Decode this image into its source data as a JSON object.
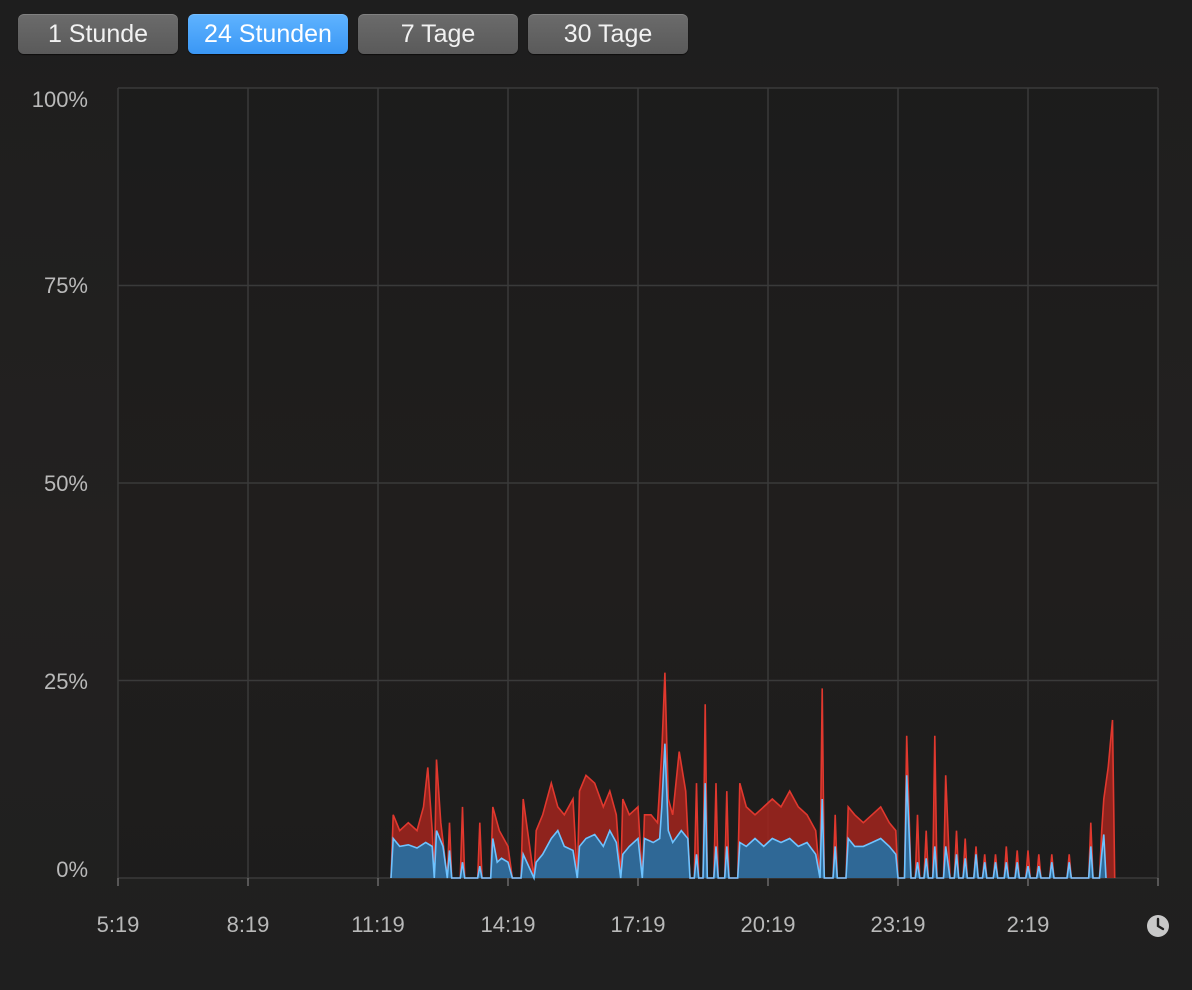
{
  "toolbar": {
    "buttons": [
      {
        "label": "1 Stunde",
        "active": false
      },
      {
        "label": "24 Stunden",
        "active": true
      },
      {
        "label": "7 Tage",
        "active": false
      },
      {
        "label": "30 Tage",
        "active": false
      }
    ]
  },
  "colors": {
    "user": "#3b82c4",
    "user_line": "#6ec3ff",
    "system": "#e0382e",
    "grid": "#3a3a3a",
    "accent": "#3a97f5"
  },
  "icons": {
    "time_icon": "clock-icon"
  },
  "chart_data": {
    "type": "area",
    "stacked": true,
    "title": "",
    "xlabel": "",
    "ylabel": "",
    "ylim": [
      0,
      100
    ],
    "y_ticks": [
      "100%",
      "75%",
      "50%",
      "25%",
      "0%"
    ],
    "x_ticks": [
      "5:19",
      "8:19",
      "11:19",
      "14:19",
      "17:19",
      "20:19",
      "23:19",
      "2:19"
    ],
    "x_range_hours": [
      0,
      24
    ],
    "grid": true,
    "series": [
      {
        "color": "#3b82c4",
        "points": [
          [
            6.3,
            0
          ],
          [
            6.35,
            5
          ],
          [
            6.5,
            4
          ],
          [
            6.7,
            4.2
          ],
          [
            6.9,
            3.8
          ],
          [
            7.1,
            4.5
          ],
          [
            7.25,
            4
          ],
          [
            7.3,
            0
          ],
          [
            7.35,
            6
          ],
          [
            7.5,
            4
          ],
          [
            7.6,
            0
          ],
          [
            7.65,
            3.5
          ],
          [
            7.7,
            0
          ],
          [
            7.9,
            0
          ],
          [
            7.95,
            2
          ],
          [
            8.0,
            0
          ],
          [
            8.3,
            0
          ],
          [
            8.35,
            1.5
          ],
          [
            8.4,
            0
          ],
          [
            8.6,
            0
          ],
          [
            8.65,
            5
          ],
          [
            8.75,
            2
          ],
          [
            8.85,
            2.5
          ],
          [
            9.0,
            2
          ],
          [
            9.1,
            0
          ],
          [
            9.3,
            0
          ],
          [
            9.35,
            3
          ],
          [
            9.6,
            0
          ],
          [
            9.65,
            2
          ],
          [
            9.8,
            3
          ],
          [
            10.0,
            5
          ],
          [
            10.15,
            6
          ],
          [
            10.3,
            4
          ],
          [
            10.5,
            3.5
          ],
          [
            10.6,
            0
          ],
          [
            10.65,
            4
          ],
          [
            10.8,
            5
          ],
          [
            11.0,
            5.5
          ],
          [
            11.2,
            4
          ],
          [
            11.35,
            6
          ],
          [
            11.5,
            4.5
          ],
          [
            11.6,
            0
          ],
          [
            11.65,
            3
          ],
          [
            11.8,
            4
          ],
          [
            12.0,
            5
          ],
          [
            12.1,
            0
          ],
          [
            12.15,
            5
          ],
          [
            12.35,
            4.5
          ],
          [
            12.5,
            5
          ],
          [
            12.55,
            9
          ],
          [
            12.62,
            17
          ],
          [
            12.7,
            6
          ],
          [
            12.8,
            4.5
          ],
          [
            13.0,
            6
          ],
          [
            13.15,
            5
          ],
          [
            13.2,
            0
          ],
          [
            13.3,
            0
          ],
          [
            13.35,
            3
          ],
          [
            13.4,
            0
          ],
          [
            13.5,
            0
          ],
          [
            13.55,
            12
          ],
          [
            13.6,
            0
          ],
          [
            13.75,
            0
          ],
          [
            13.8,
            4
          ],
          [
            13.85,
            0
          ],
          [
            14.0,
            0
          ],
          [
            14.05,
            4
          ],
          [
            14.1,
            0
          ],
          [
            14.3,
            0
          ],
          [
            14.35,
            4.5
          ],
          [
            14.5,
            4
          ],
          [
            14.7,
            5
          ],
          [
            14.9,
            4
          ],
          [
            15.1,
            5
          ],
          [
            15.3,
            4.5
          ],
          [
            15.5,
            5
          ],
          [
            15.7,
            4
          ],
          [
            15.9,
            4.5
          ],
          [
            16.1,
            3
          ],
          [
            16.2,
            0
          ],
          [
            16.25,
            10
          ],
          [
            16.3,
            0
          ],
          [
            16.5,
            0
          ],
          [
            16.55,
            4
          ],
          [
            16.6,
            0
          ],
          [
            16.8,
            0
          ],
          [
            16.85,
            5
          ],
          [
            17.0,
            4
          ],
          [
            17.2,
            4
          ],
          [
            17.4,
            4.5
          ],
          [
            17.6,
            5
          ],
          [
            17.8,
            4
          ],
          [
            17.95,
            3
          ],
          [
            18.0,
            0
          ],
          [
            18.15,
            0
          ],
          [
            18.2,
            13
          ],
          [
            18.3,
            0
          ],
          [
            18.4,
            0
          ],
          [
            18.45,
            2
          ],
          [
            18.5,
            0
          ],
          [
            18.6,
            0
          ],
          [
            18.65,
            2.5
          ],
          [
            18.7,
            0
          ],
          [
            18.8,
            0
          ],
          [
            18.85,
            4
          ],
          [
            18.9,
            0
          ],
          [
            19.05,
            0
          ],
          [
            19.1,
            4
          ],
          [
            19.2,
            0
          ],
          [
            19.3,
            0
          ],
          [
            19.35,
            3
          ],
          [
            19.4,
            0
          ],
          [
            19.5,
            0
          ],
          [
            19.55,
            2.5
          ],
          [
            19.6,
            0
          ],
          [
            19.75,
            0
          ],
          [
            19.8,
            3
          ],
          [
            19.85,
            0
          ],
          [
            19.95,
            0
          ],
          [
            20.0,
            2
          ],
          [
            20.05,
            0
          ],
          [
            20.2,
            0
          ],
          [
            20.25,
            2
          ],
          [
            20.3,
            0
          ],
          [
            20.45,
            0
          ],
          [
            20.5,
            2
          ],
          [
            20.55,
            0
          ],
          [
            20.7,
            0
          ],
          [
            20.75,
            2
          ],
          [
            20.8,
            0
          ],
          [
            20.95,
            0
          ],
          [
            21.0,
            1.5
          ],
          [
            21.05,
            0
          ],
          [
            21.2,
            0
          ],
          [
            21.25,
            1.5
          ],
          [
            21.3,
            0
          ],
          [
            21.5,
            0
          ],
          [
            21.55,
            2
          ],
          [
            21.6,
            0
          ],
          [
            21.9,
            0
          ],
          [
            21.95,
            2
          ],
          [
            22.0,
            0
          ],
          [
            22.4,
            0
          ],
          [
            22.45,
            4
          ],
          [
            22.5,
            0
          ],
          [
            22.65,
            0
          ],
          [
            22.7,
            3
          ],
          [
            22.75,
            5.5
          ],
          [
            22.8,
            0
          ]
        ]
      },
      {
        "color": "#e0382e",
        "points": [
          [
            6.3,
            0
          ],
          [
            6.35,
            8
          ],
          [
            6.5,
            6
          ],
          [
            6.7,
            7
          ],
          [
            6.9,
            6
          ],
          [
            7.05,
            9
          ],
          [
            7.15,
            14
          ],
          [
            7.25,
            6
          ],
          [
            7.3,
            0
          ],
          [
            7.35,
            15
          ],
          [
            7.45,
            7
          ],
          [
            7.6,
            0
          ],
          [
            7.65,
            7
          ],
          [
            7.7,
            0
          ],
          [
            7.9,
            0
          ],
          [
            7.95,
            9
          ],
          [
            8.0,
            0
          ],
          [
            8.3,
            0
          ],
          [
            8.35,
            7
          ],
          [
            8.4,
            0
          ],
          [
            8.6,
            0
          ],
          [
            8.65,
            9
          ],
          [
            8.8,
            6
          ],
          [
            9.0,
            4
          ],
          [
            9.1,
            0
          ],
          [
            9.3,
            0
          ],
          [
            9.35,
            10
          ],
          [
            9.6,
            0
          ],
          [
            9.65,
            6
          ],
          [
            9.8,
            8
          ],
          [
            10.0,
            12
          ],
          [
            10.15,
            9
          ],
          [
            10.3,
            8
          ],
          [
            10.5,
            10
          ],
          [
            10.6,
            0
          ],
          [
            10.65,
            11
          ],
          [
            10.8,
            13
          ],
          [
            11.0,
            12
          ],
          [
            11.2,
            9
          ],
          [
            11.35,
            11
          ],
          [
            11.5,
            8
          ],
          [
            11.6,
            0
          ],
          [
            11.65,
            10
          ],
          [
            11.8,
            8
          ],
          [
            12.0,
            9
          ],
          [
            12.1,
            0
          ],
          [
            12.15,
            8
          ],
          [
            12.3,
            8
          ],
          [
            12.45,
            7
          ],
          [
            12.55,
            16
          ],
          [
            12.62,
            26
          ],
          [
            12.7,
            10
          ],
          [
            12.8,
            8
          ],
          [
            12.95,
            16
          ],
          [
            13.1,
            11
          ],
          [
            13.2,
            0
          ],
          [
            13.3,
            0
          ],
          [
            13.35,
            12
          ],
          [
            13.4,
            0
          ],
          [
            13.5,
            0
          ],
          [
            13.55,
            22
          ],
          [
            13.6,
            0
          ],
          [
            13.75,
            0
          ],
          [
            13.8,
            12
          ],
          [
            13.85,
            0
          ],
          [
            14.0,
            0
          ],
          [
            14.05,
            11
          ],
          [
            14.1,
            0
          ],
          [
            14.3,
            0
          ],
          [
            14.35,
            12
          ],
          [
            14.5,
            9
          ],
          [
            14.7,
            8
          ],
          [
            14.9,
            9
          ],
          [
            15.1,
            10
          ],
          [
            15.3,
            9
          ],
          [
            15.5,
            11
          ],
          [
            15.7,
            9
          ],
          [
            15.9,
            8
          ],
          [
            16.1,
            6
          ],
          [
            16.2,
            0
          ],
          [
            16.25,
            24
          ],
          [
            16.3,
            0
          ],
          [
            16.5,
            0
          ],
          [
            16.55,
            8
          ],
          [
            16.6,
            0
          ],
          [
            16.8,
            0
          ],
          [
            16.85,
            9
          ],
          [
            17.0,
            8
          ],
          [
            17.2,
            7
          ],
          [
            17.4,
            8
          ],
          [
            17.6,
            9
          ],
          [
            17.8,
            7
          ],
          [
            17.95,
            6
          ],
          [
            18.0,
            0
          ],
          [
            18.15,
            0
          ],
          [
            18.2,
            18
          ],
          [
            18.3,
            0
          ],
          [
            18.4,
            0
          ],
          [
            18.45,
            8
          ],
          [
            18.5,
            0
          ],
          [
            18.6,
            0
          ],
          [
            18.65,
            6
          ],
          [
            18.7,
            0
          ],
          [
            18.8,
            0
          ],
          [
            18.85,
            18
          ],
          [
            18.9,
            0
          ],
          [
            19.05,
            0
          ],
          [
            19.1,
            13
          ],
          [
            19.2,
            0
          ],
          [
            19.3,
            0
          ],
          [
            19.35,
            6
          ],
          [
            19.4,
            0
          ],
          [
            19.5,
            0
          ],
          [
            19.55,
            5
          ],
          [
            19.6,
            0
          ],
          [
            19.75,
            0
          ],
          [
            19.8,
            4
          ],
          [
            19.85,
            0
          ],
          [
            19.95,
            0
          ],
          [
            20.0,
            3
          ],
          [
            20.05,
            0
          ],
          [
            20.2,
            0
          ],
          [
            20.25,
            3
          ],
          [
            20.3,
            0
          ],
          [
            20.45,
            0
          ],
          [
            20.5,
            4
          ],
          [
            20.55,
            0
          ],
          [
            20.7,
            0
          ],
          [
            20.75,
            3.5
          ],
          [
            20.8,
            0
          ],
          [
            20.95,
            0
          ],
          [
            21.0,
            3.5
          ],
          [
            21.05,
            0
          ],
          [
            21.2,
            0
          ],
          [
            21.25,
            3
          ],
          [
            21.3,
            0
          ],
          [
            21.5,
            0
          ],
          [
            21.55,
            3
          ],
          [
            21.6,
            0
          ],
          [
            21.9,
            0
          ],
          [
            21.95,
            3
          ],
          [
            22.0,
            0
          ],
          [
            22.4,
            0
          ],
          [
            22.45,
            7
          ],
          [
            22.5,
            0
          ],
          [
            22.65,
            0
          ],
          [
            22.7,
            6
          ],
          [
            22.75,
            10
          ],
          [
            22.85,
            14
          ],
          [
            22.95,
            20
          ],
          [
            23.0,
            0
          ]
        ]
      }
    ]
  }
}
